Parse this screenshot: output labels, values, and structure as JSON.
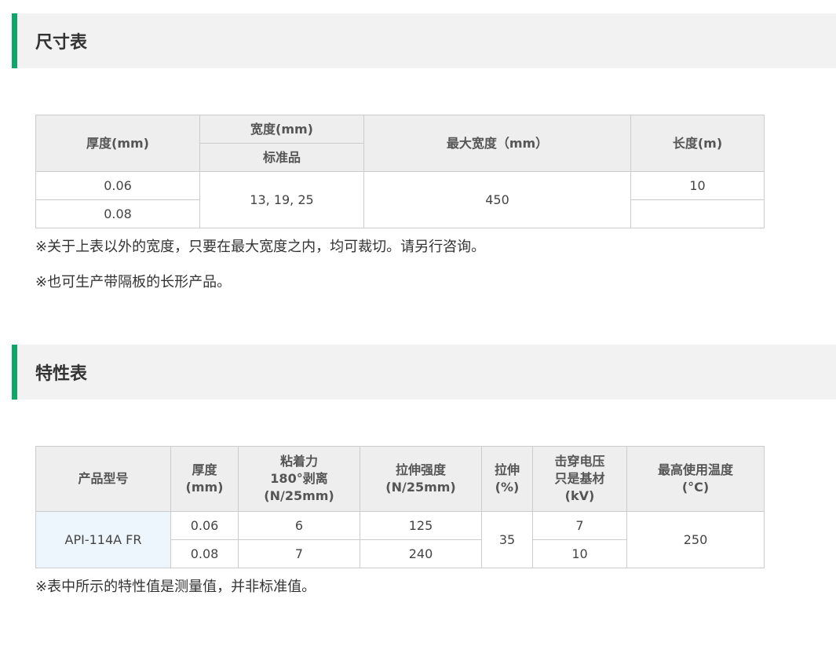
{
  "section1": {
    "title": "尺寸表"
  },
  "size_table": {
    "headers": {
      "thickness": "厚度(mm)",
      "width": "宽度(mm)",
      "standard": "标准品",
      "max_width": "最大宽度（mm）",
      "length": "长度(m)"
    },
    "rows": [
      {
        "thickness": "0.06",
        "length": "10"
      },
      {
        "thickness": "0.08",
        "length": ""
      }
    ],
    "width_value": "13, 19, 25",
    "max_width_value": "450"
  },
  "notes_section1": [
    "※关于上表以外的宽度，只要在最大宽度之内，均可裁切。请另行咨询。",
    "※也可生产带隔板的长形产品。"
  ],
  "section2": {
    "title": "特性表"
  },
  "prop_table": {
    "headers": {
      "model": "产品型号",
      "thickness_l1": "厚度",
      "thickness_l2": "(mm)",
      "adhesion_l1": "粘着力",
      "adhesion_l2": "180°剥离",
      "adhesion_l3": "(N/25mm)",
      "tensile_l1": "拉伸强度",
      "tensile_l2": "(N/25mm)",
      "elongation_l1": "拉伸",
      "elongation_l2": "(%)",
      "breakdown_l1": "击穿电压",
      "breakdown_l2": "只是基材",
      "breakdown_l3": "(kV)",
      "maxtemp_l1": "最高使用温度",
      "maxtemp_l2": "(°C)"
    },
    "model": "API-114A FR",
    "rows": [
      {
        "thickness": "0.06",
        "adhesion": "6",
        "tensile": "125",
        "breakdown": "7"
      },
      {
        "thickness": "0.08",
        "adhesion": "7",
        "tensile": "240",
        "breakdown": "10"
      }
    ],
    "elongation": "35",
    "max_temp": "250"
  },
  "notes_section2": [
    "※表中所示的特性值是测量值，并非标准值。"
  ]
}
